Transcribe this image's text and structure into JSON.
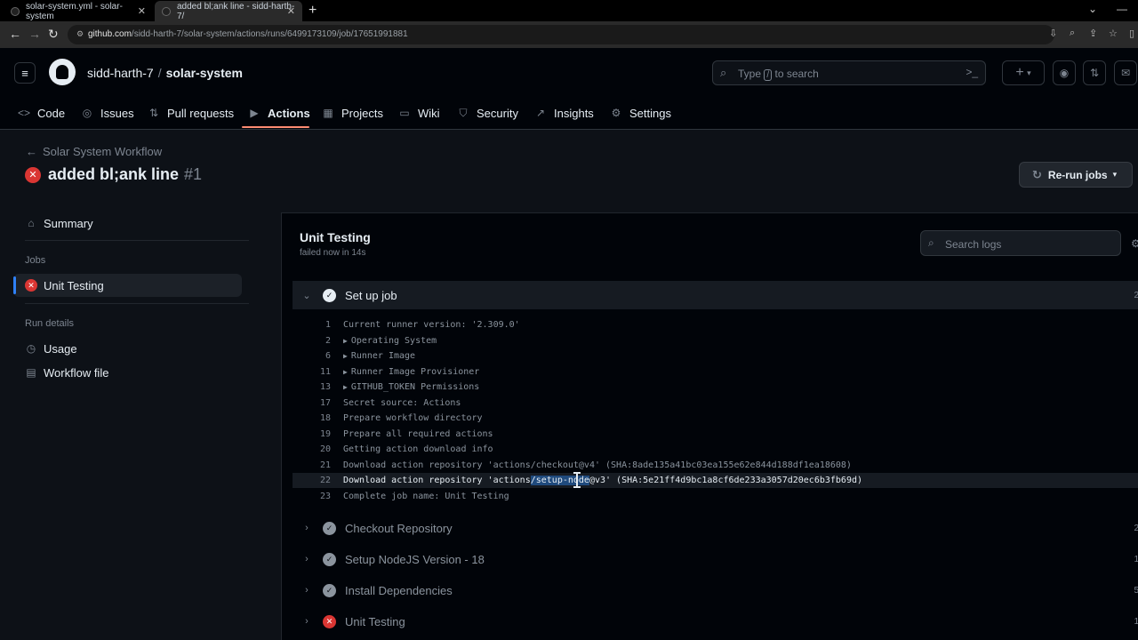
{
  "browser": {
    "tabs": [
      {
        "title": "solar-system.yml - solar-system"
      },
      {
        "title": "added bl;ank line - sidd-harth-7/"
      }
    ],
    "url_host": "github.com",
    "url_path": "/sidd-harth-7/solar-system/actions/runs/6499173109/job/17651991881"
  },
  "header": {
    "owner": "sidd-harth-7",
    "separator": "/",
    "repo": "solar-system",
    "search_placeholder_pre": "Type",
    "search_key": "/",
    "search_placeholder_post": "to search",
    "plus_label": "+",
    "plus_caret": "▾"
  },
  "repo_nav": {
    "items": [
      {
        "label": "Code",
        "icon": "code-icon"
      },
      {
        "label": "Issues",
        "icon": "issue-icon"
      },
      {
        "label": "Pull requests",
        "icon": "pull-request-icon"
      },
      {
        "label": "Actions",
        "icon": "play-icon"
      },
      {
        "label": "Projects",
        "icon": "table-icon"
      },
      {
        "label": "Wiki",
        "icon": "book-icon"
      },
      {
        "label": "Security",
        "icon": "shield-icon"
      },
      {
        "label": "Insights",
        "icon": "graph-icon"
      },
      {
        "label": "Settings",
        "icon": "gear-icon"
      }
    ],
    "active": "Actions"
  },
  "run": {
    "back_label": "Solar System Workflow",
    "title": "added bl;ank line",
    "number": "#1",
    "rerun_label": "Re-run jobs"
  },
  "sidebar": {
    "summary": "Summary",
    "jobs_heading": "Jobs",
    "job": "Unit Testing",
    "run_details_heading": "Run details",
    "usage": "Usage",
    "workflow_file": "Workflow file"
  },
  "job": {
    "title": "Unit Testing",
    "subtitle": "failed now in 14s",
    "search_placeholder": "Search logs",
    "open_step": {
      "name": "Set up job",
      "duration": "2"
    },
    "log_lines": [
      {
        "n": "1",
        "text": "Current runner version: '2.309.0'",
        "expandable": false
      },
      {
        "n": "2",
        "text": "Operating System",
        "expandable": true
      },
      {
        "n": "6",
        "text": "Runner Image",
        "expandable": true
      },
      {
        "n": "11",
        "text": "Runner Image Provisioner",
        "expandable": true
      },
      {
        "n": "13",
        "text": "GITHUB_TOKEN Permissions",
        "expandable": true
      },
      {
        "n": "17",
        "text": "Secret source: Actions",
        "expandable": false
      },
      {
        "n": "18",
        "text": "Prepare workflow directory",
        "expandable": false
      },
      {
        "n": "19",
        "text": "Prepare all required actions",
        "expandable": false
      },
      {
        "n": "20",
        "text": "Getting action download info",
        "expandable": false
      },
      {
        "n": "21",
        "text": "Download action repository 'actions/checkout@v4' (SHA:8ade135a41bc03ea155e62e844d188df1ea18608)",
        "expandable": false
      }
    ],
    "highlight_line": {
      "n": "22",
      "pre": "Download action repository 'actions",
      "selected": "/setup-node",
      "post": "@v3' (SHA:5e21ff4d9bc1a8cf6de233a3057d20ec6b3fb69d)"
    },
    "last_line": {
      "n": "23",
      "text": "Complete job name: Unit Testing"
    },
    "steps": [
      {
        "name": "Checkout Repository",
        "status": "success",
        "duration": "2"
      },
      {
        "name": "Setup NodeJS Version - 18",
        "status": "success",
        "duration": "1"
      },
      {
        "name": "Install Dependencies",
        "status": "success",
        "duration": "5"
      },
      {
        "name": "Unit Testing",
        "status": "failure",
        "duration": "1"
      }
    ]
  },
  "colors": {
    "bg": "#0d1117",
    "header_bg": "#010409",
    "accent_underline": "#fd8c73",
    "failure": "#da3633",
    "active_bar": "#2f81f7"
  }
}
